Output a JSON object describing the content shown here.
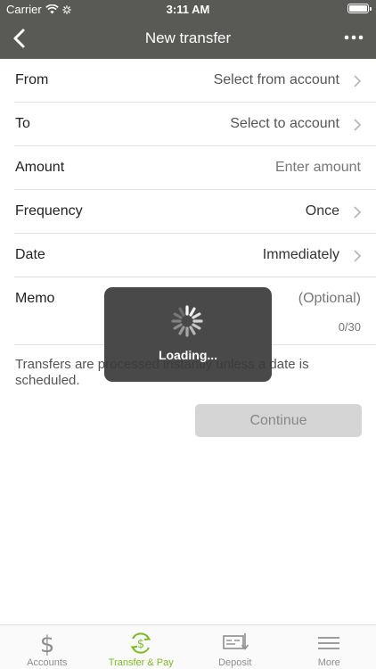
{
  "status_bar": {
    "carrier": "Carrier",
    "time": "3:11 AM"
  },
  "nav": {
    "title": "New transfer",
    "back_icon": "chevron-left-icon",
    "more_icon": "ellipsis-icon"
  },
  "form": {
    "from": {
      "label": "From",
      "value": "Select from account"
    },
    "to": {
      "label": "To",
      "value": "Select to account"
    },
    "amount": {
      "label": "Amount",
      "placeholder": "Enter amount"
    },
    "frequency": {
      "label": "Frequency",
      "value": "Once"
    },
    "date": {
      "label": "Date",
      "value": "Immediately"
    },
    "memo": {
      "label": "Memo",
      "placeholder": "(Optional)",
      "counter": "0/30"
    }
  },
  "info_text": "Transfers are processed instantly unless a date is scheduled.",
  "continue_label": "Continue",
  "loading": {
    "text": "Loading..."
  },
  "tabs": [
    {
      "label": "Accounts",
      "icon": "dollar-icon",
      "active": false
    },
    {
      "label": "Transfer & Pay",
      "icon": "transfer-pay-icon",
      "active": true
    },
    {
      "label": "Deposit",
      "icon": "check-deposit-icon",
      "active": false
    },
    {
      "label": "More",
      "icon": "hamburger-menu-icon",
      "active": false
    }
  ],
  "colors": {
    "header": "#595a55",
    "accent": "#7cba28",
    "button_disabled": "#d5d5d5"
  }
}
